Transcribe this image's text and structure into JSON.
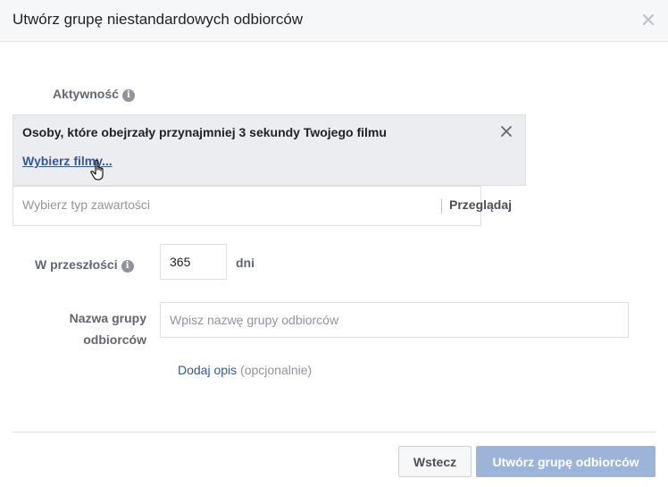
{
  "dialog": {
    "title": "Utwórz grupę niestandardowych odbiorców",
    "close_icon": "close-icon"
  },
  "activity": {
    "label": "Aktywność",
    "info_icon": "info-icon",
    "selected_text": "Osoby, które obejrzały przynajmniej 3 sekundy Twojego filmu",
    "choose_link": "Wybierz filmy...",
    "remove_icon": "close-icon"
  },
  "content_type": {
    "placeholder": "Wybierz typ zawartości",
    "browse_label": "Przeglądaj"
  },
  "retention": {
    "label": "W przeszłości",
    "info_icon": "info-icon",
    "value": "365",
    "unit": "dni"
  },
  "audience_name": {
    "label_line1": "Nazwa grupy",
    "label_line2": "odbiorców",
    "placeholder": "Wpisz nazwę grupy odbiorców"
  },
  "description": {
    "link": "Dodaj opis",
    "optional": "(opcjonalnie)"
  },
  "footer": {
    "back_label": "Wstecz",
    "create_label": "Utwórz grupę odbiorców"
  },
  "colors": {
    "link": "#365899",
    "primary_disabled": "#9cb4d8",
    "header_bg": "#f6f7f9"
  }
}
